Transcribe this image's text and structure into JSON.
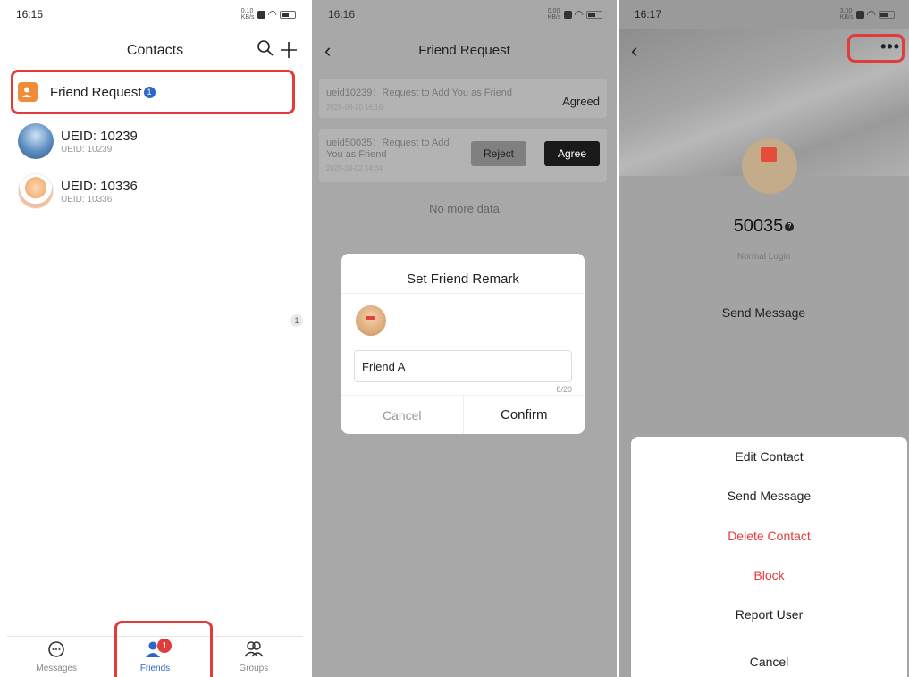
{
  "panel1": {
    "time": "16:15",
    "net_speed": "0.10\nKB/s",
    "title": "Contacts",
    "friend_request_label": "Friend Request",
    "friend_request_badge": "1",
    "contacts": [
      {
        "name": "UEID: 10239",
        "sub": "UEID: 10239"
      },
      {
        "name": "UEID: 10336",
        "sub": "UEID: 10336"
      }
    ],
    "count_badge": "1",
    "tabs": [
      {
        "label": "Messages"
      },
      {
        "label": "Friends",
        "badge": "1"
      },
      {
        "label": "Groups"
      }
    ]
  },
  "panel2": {
    "time": "16:16",
    "net_speed": "0.00\nKB/s",
    "title": "Friend Request",
    "requests": [
      {
        "text": "ueid10239：Request to Add You as Friend",
        "time": "2025-08-20 16:16",
        "status": "Agreed"
      },
      {
        "text_line1": "ueid50035：Request to Add",
        "text_line2": "You as Friend",
        "time": "2025-09-02 14:34",
        "reject": "Reject",
        "agree": "Agree"
      }
    ],
    "no_more": "No more data",
    "dialog": {
      "title": "Set Friend Remark",
      "input_value": "Friend A",
      "char_count": "8/20",
      "cancel": "Cancel",
      "confirm": "Confirm"
    }
  },
  "panel3": {
    "time": "16:17",
    "net_speed": "3.00\nKB/s",
    "name": "50035",
    "login_status": "Normal Login",
    "send_message": "Send Message",
    "sheet": [
      {
        "label": "Edit Contact",
        "danger": false
      },
      {
        "label": "Send Message",
        "danger": false
      },
      {
        "label": "Delete Contact",
        "danger": true
      },
      {
        "label": "Block",
        "danger": true
      },
      {
        "label": "Report User",
        "danger": false
      },
      {
        "label": "Cancel",
        "danger": false
      }
    ]
  },
  "colors": {
    "highlight": "#e23b3b",
    "accent": "#2b67c9",
    "danger": "#e23b3b",
    "overlay_dim": "#a8a8a8"
  }
}
